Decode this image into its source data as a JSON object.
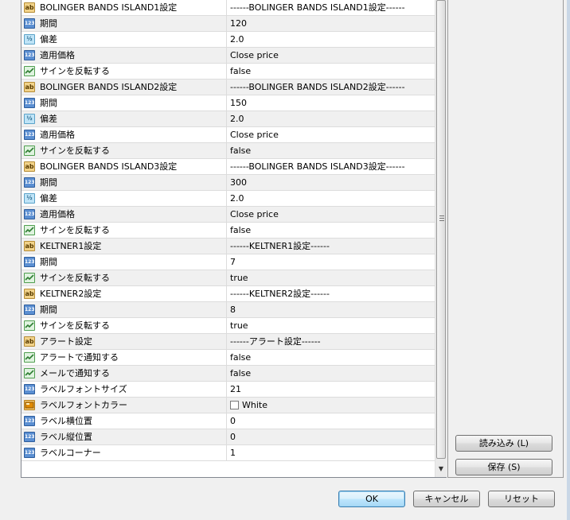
{
  "rows": [
    {
      "type": "string",
      "icon": "ab",
      "name": "BOLINGER BANDS ISLAND1設定",
      "value": "------BOLINGER BANDS ISLAND1設定------"
    },
    {
      "type": "int",
      "icon": "123",
      "name": "期間",
      "value": "120"
    },
    {
      "type": "double",
      "icon": "½",
      "name": "偏差",
      "value": "2.0"
    },
    {
      "type": "int",
      "icon": "123",
      "name": "適用価格",
      "value": "Close price"
    },
    {
      "type": "bool",
      "icon": "",
      "name": "サインを反転する",
      "value": "false"
    },
    {
      "type": "string",
      "icon": "ab",
      "name": "BOLINGER BANDS ISLAND2設定",
      "value": "------BOLINGER BANDS ISLAND2設定------"
    },
    {
      "type": "int",
      "icon": "123",
      "name": "期間",
      "value": "150"
    },
    {
      "type": "double",
      "icon": "½",
      "name": "偏差",
      "value": "2.0"
    },
    {
      "type": "int",
      "icon": "123",
      "name": "適用価格",
      "value": "Close price"
    },
    {
      "type": "bool",
      "icon": "",
      "name": "サインを反転する",
      "value": "false"
    },
    {
      "type": "string",
      "icon": "ab",
      "name": "BOLINGER BANDS ISLAND3設定",
      "value": "------BOLINGER BANDS ISLAND3設定------"
    },
    {
      "type": "int",
      "icon": "123",
      "name": "期間",
      "value": "300"
    },
    {
      "type": "double",
      "icon": "½",
      "name": "偏差",
      "value": "2.0"
    },
    {
      "type": "int",
      "icon": "123",
      "name": "適用価格",
      "value": "Close price"
    },
    {
      "type": "bool",
      "icon": "",
      "name": "サインを反転する",
      "value": "false"
    },
    {
      "type": "string",
      "icon": "ab",
      "name": "KELTNER1設定",
      "value": "------KELTNER1設定------"
    },
    {
      "type": "int",
      "icon": "123",
      "name": "期間",
      "value": "7"
    },
    {
      "type": "bool",
      "icon": "",
      "name": "サインを反転する",
      "value": "true"
    },
    {
      "type": "string",
      "icon": "ab",
      "name": "KELTNER2設定",
      "value": "------KELTNER2設定------"
    },
    {
      "type": "int",
      "icon": "123",
      "name": "期間",
      "value": "8"
    },
    {
      "type": "bool",
      "icon": "",
      "name": "サインを反転する",
      "value": "true"
    },
    {
      "type": "string",
      "icon": "ab",
      "name": "アラート設定",
      "value": "------アラート設定------"
    },
    {
      "type": "bool",
      "icon": "",
      "name": "アラートで通知する",
      "value": "false"
    },
    {
      "type": "bool",
      "icon": "",
      "name": "メールで通知する",
      "value": "false"
    },
    {
      "type": "int",
      "icon": "123",
      "name": "ラベルフォントサイズ",
      "value": "21"
    },
    {
      "type": "color",
      "icon": "",
      "name": "ラベルフォントカラー",
      "value": "White",
      "swatch": "#ffffff"
    },
    {
      "type": "int",
      "icon": "123",
      "name": "ラベル横位置",
      "value": "0"
    },
    {
      "type": "int",
      "icon": "123",
      "name": "ラベル縦位置",
      "value": "0"
    },
    {
      "type": "int",
      "icon": "123",
      "name": "ラベルコーナー",
      "value": "1"
    }
  ],
  "buttons": {
    "load": "読み込み (L)",
    "save": "保存 (S)",
    "ok": "OK",
    "cancel": "キャンセル",
    "reset": "リセット"
  },
  "colors": {
    "alt_row": "#f0f0f0",
    "grid_line": "#dcdcdc",
    "ok_accent": "#3c7fb1"
  }
}
